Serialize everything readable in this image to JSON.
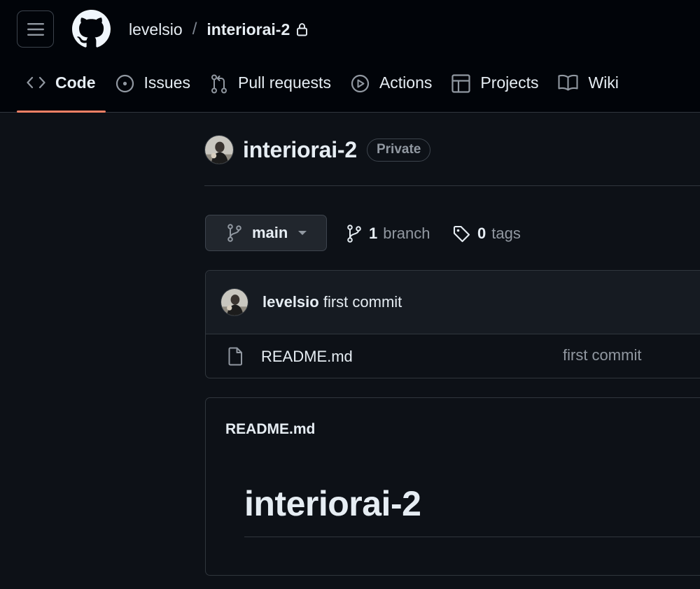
{
  "header": {
    "breadcrumb": {
      "owner": "levelsio",
      "separator": "/",
      "repo": "interiorai-2"
    },
    "tabs": [
      {
        "id": "code",
        "label": "Code",
        "icon": "code-icon",
        "active": true
      },
      {
        "id": "issues",
        "label": "Issues",
        "icon": "issue-opened-icon"
      },
      {
        "id": "pulls",
        "label": "Pull requests",
        "icon": "git-pull-request-icon"
      },
      {
        "id": "actions",
        "label": "Actions",
        "icon": "play-icon"
      },
      {
        "id": "projects",
        "label": "Projects",
        "icon": "table-icon"
      },
      {
        "id": "wiki",
        "label": "Wiki",
        "icon": "book-icon"
      }
    ]
  },
  "repo": {
    "name": "interiorai-2",
    "visibility": "Private"
  },
  "branch_bar": {
    "current_branch": "main",
    "branches": {
      "count": "1",
      "label": "branch"
    },
    "tags": {
      "count": "0",
      "label": "tags"
    }
  },
  "latest_commit": {
    "author": "levelsio",
    "message": "first commit"
  },
  "files": [
    {
      "name": "README.md",
      "last_commit": "first commit",
      "icon": "file-icon"
    }
  ],
  "readme": {
    "filename": "README.md",
    "heading": "interiorai-2"
  },
  "colors": {
    "header_bg": "#010409",
    "page_bg": "#0d1117",
    "box_header_bg": "#161b22",
    "border": "#30363d",
    "accent_underline": "#f78166",
    "text_primary": "#e6edf3",
    "text_muted": "#9198a1"
  }
}
